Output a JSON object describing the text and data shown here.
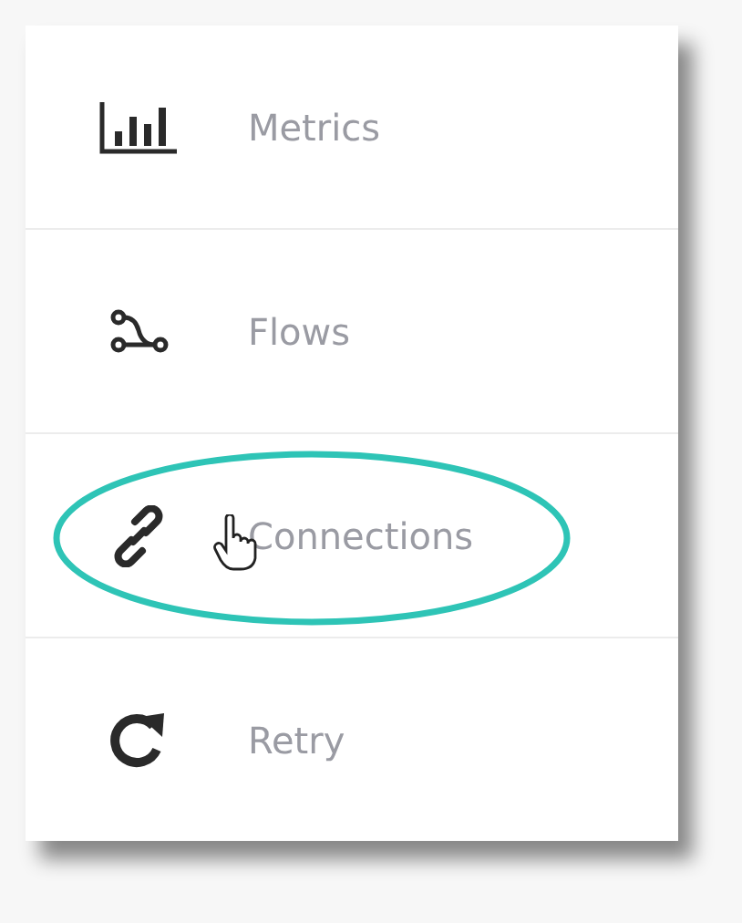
{
  "menu": {
    "items": [
      {
        "kind": "metrics",
        "label": "Metrics",
        "highlighted": false
      },
      {
        "kind": "flows",
        "label": "Flows",
        "highlighted": false
      },
      {
        "kind": "connections",
        "label": "Connections",
        "highlighted": true
      },
      {
        "kind": "retry",
        "label": "Retry",
        "highlighted": false
      }
    ]
  }
}
